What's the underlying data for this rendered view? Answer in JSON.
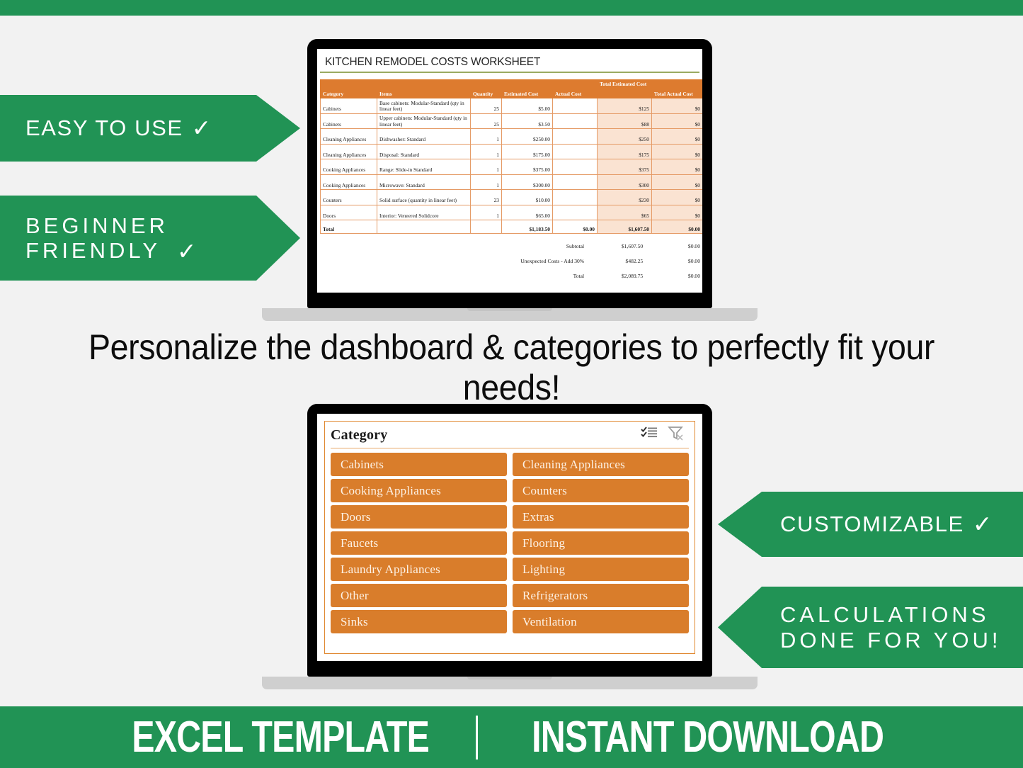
{
  "footer": {
    "left_label": "EXCEL TEMPLATE",
    "right_label": "INSTANT DOWNLOAD"
  },
  "headline": "Personalize the dashboard & categories to\nperfectly fit your needs!",
  "banners": [
    {
      "id": "easy",
      "label": "EASY TO USE",
      "check": "✓",
      "side": "left"
    },
    {
      "id": "begin",
      "label": "BEGINNER\nFRIENDLY",
      "check": "✓",
      "side": "left"
    },
    {
      "id": "custom",
      "label": "CUSTOMIZABLE",
      "check": "✓",
      "side": "right"
    },
    {
      "id": "calc",
      "label": "CALCULATIONS\nDONE FOR YOU!",
      "check": "",
      "side": "right"
    }
  ],
  "spreadsheet": {
    "title": "KITCHEN REMODEL COSTS WORKSHEET",
    "columns": [
      "Category",
      "Items",
      "Quantity",
      "Estimated Cost",
      "Actual Cost",
      "Total Estimated Cost",
      "Total Actual Cost"
    ],
    "rows": [
      {
        "category": "Cabinets",
        "item": "Base cabinets: Modular-Standard (qty in linear feet)",
        "qty": "25",
        "est": "$5.00",
        "act": "",
        "total_est": "$125",
        "total_act": "$0"
      },
      {
        "category": "Cabinets",
        "item": "Upper cabinets: Modular-Standard (qty in linear feet)",
        "qty": "25",
        "est": "$3.50",
        "act": "",
        "total_est": "$88",
        "total_act": "$0"
      },
      {
        "category": "Cleaning Appliances",
        "item": "Dishwasher: Standard",
        "qty": "1",
        "est": "$250.00",
        "act": "",
        "total_est": "$250",
        "total_act": "$0"
      },
      {
        "category": "Cleaning Appliances",
        "item": "Disposal: Standard",
        "qty": "1",
        "est": "$175.00",
        "act": "",
        "total_est": "$175",
        "total_act": "$0"
      },
      {
        "category": "Cooking Appliances",
        "item": "Range: Slide-in Standard",
        "qty": "1",
        "est": "$375.00",
        "act": "",
        "total_est": "$375",
        "total_act": "$0"
      },
      {
        "category": "Cooking Appliances",
        "item": "Microwave: Standard",
        "qty": "1",
        "est": "$300.00",
        "act": "",
        "total_est": "$300",
        "total_act": "$0"
      },
      {
        "category": "Counters",
        "item": "Solid surface (quantity in linear feet)",
        "qty": "23",
        "est": "$10.00",
        "act": "",
        "total_est": "$230",
        "total_act": "$0"
      },
      {
        "category": "Doors",
        "item": "Interior: Veneered Solidcore",
        "qty": "1",
        "est": "$65.00",
        "act": "",
        "total_est": "$65",
        "total_act": "$0"
      }
    ],
    "total_row": {
      "label": "Total",
      "item": "",
      "qty": "",
      "est": "$1,183.50",
      "act": "$0.00",
      "total_est": "$1,607.50",
      "total_act": "$0.00"
    },
    "summary": [
      {
        "label": "Subtotal",
        "estimated": "$1,607.50",
        "actual": "$0.00"
      },
      {
        "label": "Unexpected Costs - Add 30%",
        "estimated": "$482.25",
        "actual": "$0.00"
      },
      {
        "label": "Total",
        "estimated": "$2,089.75",
        "actual": "$0.00"
      }
    ]
  },
  "slicer": {
    "title": "Category",
    "icons": [
      "multi-select-icon",
      "clear-filter-icon"
    ],
    "items": [
      "Cabinets",
      "Cleaning Appliances",
      "Cooking Appliances",
      "Counters",
      "Doors",
      "Extras",
      "Faucets",
      "Flooring",
      "Laundry Appliances",
      "Lighting",
      "Other",
      "Refrigerators",
      "Sinks",
      "Ventilation"
    ]
  },
  "colors": {
    "green": "#219355",
    "orange": "#dd7b2f",
    "orange_light": "#fae3d2",
    "background": "#f2f2f2",
    "title_rule": "#9aab62"
  }
}
